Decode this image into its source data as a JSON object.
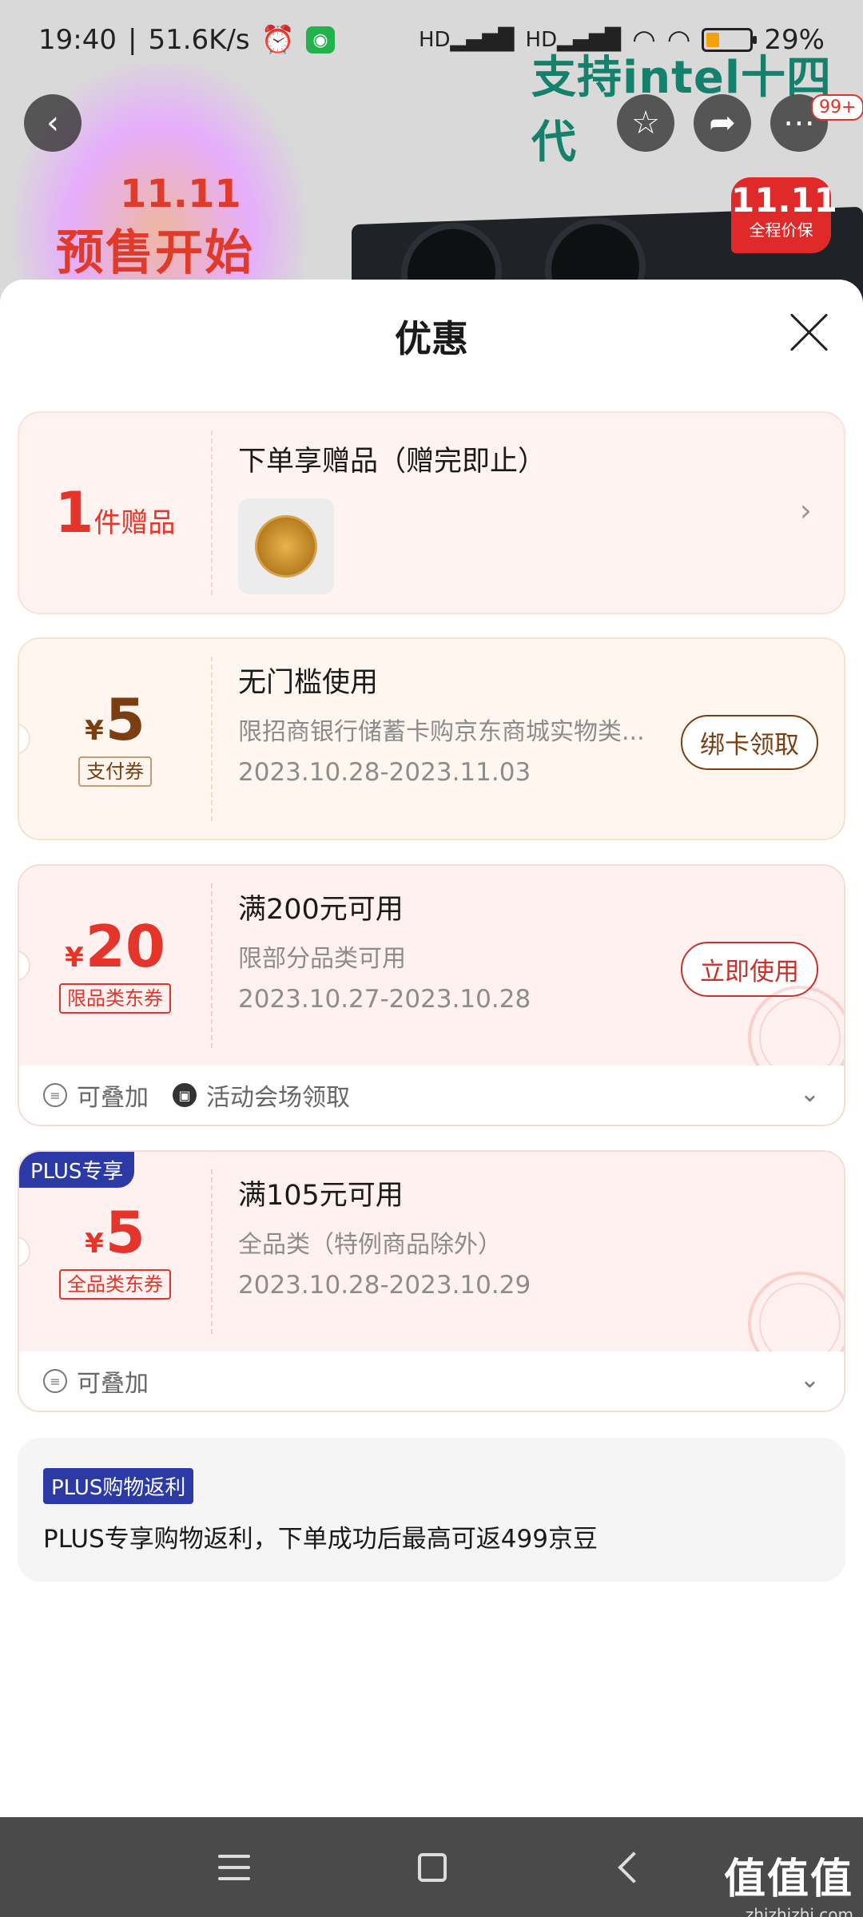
{
  "status_bar": {
    "time": "19:40",
    "separator": "|",
    "net_speed": "51.6K/s",
    "battery": "29%",
    "icons": [
      "alarm-icon",
      "wechat-icon",
      "hd-signal-icon",
      "wifi-icon",
      "battery-icon"
    ]
  },
  "background": {
    "sale_badge_top": "11.11",
    "sale_text": "预售开始",
    "slogan": "支持intel十四代",
    "badge_top": "11.11",
    "badge_bottom": "全程价保",
    "more_badge": "99+"
  },
  "sheet": {
    "title": "优惠"
  },
  "gift_card": {
    "count": "1",
    "unit": "件赠品",
    "title": "下单享赠品（赠完即止）"
  },
  "coupons": [
    {
      "yen": "¥",
      "amount": "5",
      "tag": "支付券",
      "title": "无门槛使用",
      "subtitle": "限招商银行储蓄卡购京东商城实物类...",
      "date": "2023.10.28-2023.11.03",
      "button": "绑卡领取"
    },
    {
      "yen": "¥",
      "amount": "20",
      "tag": "限品类东券",
      "title": "满200元可用",
      "subtitle": "限部分品类可用",
      "date": "2023.10.27-2023.10.28",
      "button": "立即使用",
      "extras": [
        "可叠加",
        "活动会场领取"
      ]
    },
    {
      "badge": "PLUS专享",
      "yen": "¥",
      "amount": "5",
      "tag": "全品类东券",
      "title": "满105元可用",
      "subtitle": "全品类（特例商品除外）",
      "date": "2023.10.28-2023.10.29",
      "extras": [
        "可叠加"
      ]
    }
  ],
  "rebate": {
    "tag": "PLUS购物返利",
    "text": "PLUS专享购物返利，下单成功后最高可返499京豆"
  },
  "watermark": {
    "brand": "值值值",
    "domain": "zhizhizhi.com"
  },
  "colors": {
    "accent_red": "#e5352b",
    "pay_brown": "#7a3e12",
    "plus_blue": "#2b3aa5"
  }
}
